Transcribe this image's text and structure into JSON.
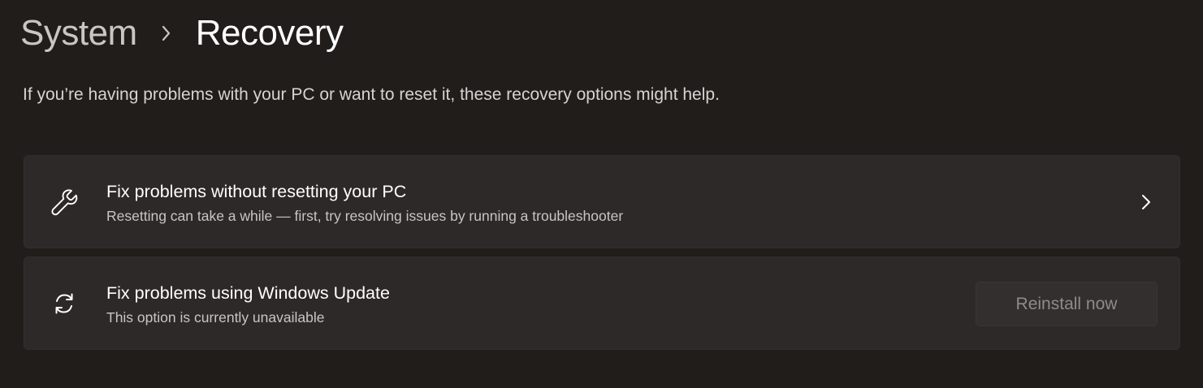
{
  "breadcrumb": {
    "parent": "System",
    "separator_icon": "chevron-right-icon",
    "current": "Recovery"
  },
  "description": "If you’re having problems with your PC or want to reset it, these recovery options might help.",
  "options": [
    {
      "icon": "wrench-icon",
      "title": "Fix problems without resetting your PC",
      "subtitle": "Resetting can take a while — first, try resolving issues by running a troubleshooter",
      "action_icon": "chevron-right-icon"
    },
    {
      "icon": "refresh-icon",
      "title": "Fix problems using Windows Update",
      "subtitle": "This option is currently unavailable",
      "button_label": "Reinstall now",
      "button_enabled": false
    }
  ],
  "colors": {
    "background": "#211d1b",
    "card": "#2d2928",
    "text_primary": "#ffffff",
    "text_secondary": "#c8c5c3",
    "disabled_text": "#8f8b89"
  }
}
